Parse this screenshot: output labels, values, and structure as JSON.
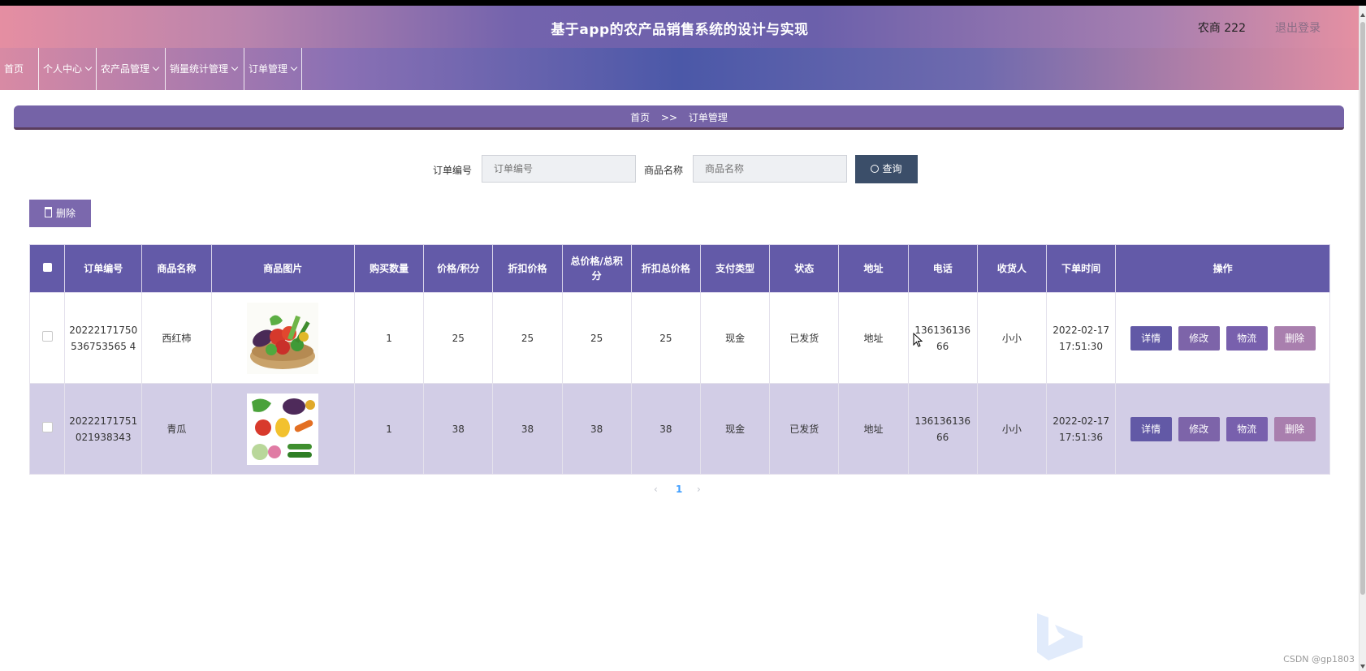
{
  "app": {
    "title": "基于app的农产品销售系统的设计与实现"
  },
  "user": {
    "name": "农商 222",
    "logout": "退出登录"
  },
  "nav": [
    {
      "label": "首页"
    },
    {
      "label": "个人中心"
    },
    {
      "label": "农产品管理"
    },
    {
      "label": "销量统计管理"
    },
    {
      "label": "订单管理"
    }
  ],
  "breadcrumb": {
    "home": "首页",
    "sep": ">>",
    "current": "订单管理"
  },
  "search": {
    "order_label": "订单编号",
    "order_placeholder": "订单编号",
    "product_label": "商品名称",
    "product_placeholder": "商品名称",
    "button": "查询"
  },
  "toolbar": {
    "delete": "删除"
  },
  "table": {
    "headers": [
      "订单编号",
      "商品名称",
      "商品图片",
      "购买数量",
      "价格/积分",
      "折扣价格",
      "总价格/总积分",
      "折扣总价格",
      "支付类型",
      "状态",
      "地址",
      "电话",
      "收货人",
      "下单时间",
      "操作"
    ],
    "rows": [
      {
        "order_no": "20222171750536753565 4",
        "product": "西红柿",
        "image": "vegetable-basket",
        "qty": "1",
        "price": "25",
        "discount_price": "25",
        "total": "25",
        "discount_total": "25",
        "pay_type": "现金",
        "status": "已发货",
        "address": "地址",
        "phone": "13613613666",
        "receiver": "小小",
        "time": "2022-02-17 17:51:30"
      },
      {
        "order_no": "20222171751021938343",
        "product": "青瓜",
        "image": "vegetable-collage",
        "qty": "1",
        "price": "38",
        "discount_price": "38",
        "total": "38",
        "discount_total": "38",
        "pay_type": "现金",
        "status": "已发货",
        "address": "地址",
        "phone": "13613613666",
        "receiver": "小小",
        "time": "2022-02-17 17:51:36"
      }
    ],
    "actions": {
      "detail": "详情",
      "edit": "修改",
      "logistics": "物流",
      "delete": "删除"
    }
  },
  "pagination": {
    "current": "1"
  },
  "watermark": "CSDN @gp1803",
  "colors": {
    "header": "#6b60ab",
    "table_header": "#635aa8",
    "alt_row": "#d2cde6",
    "search_button": "#3b4e69"
  }
}
